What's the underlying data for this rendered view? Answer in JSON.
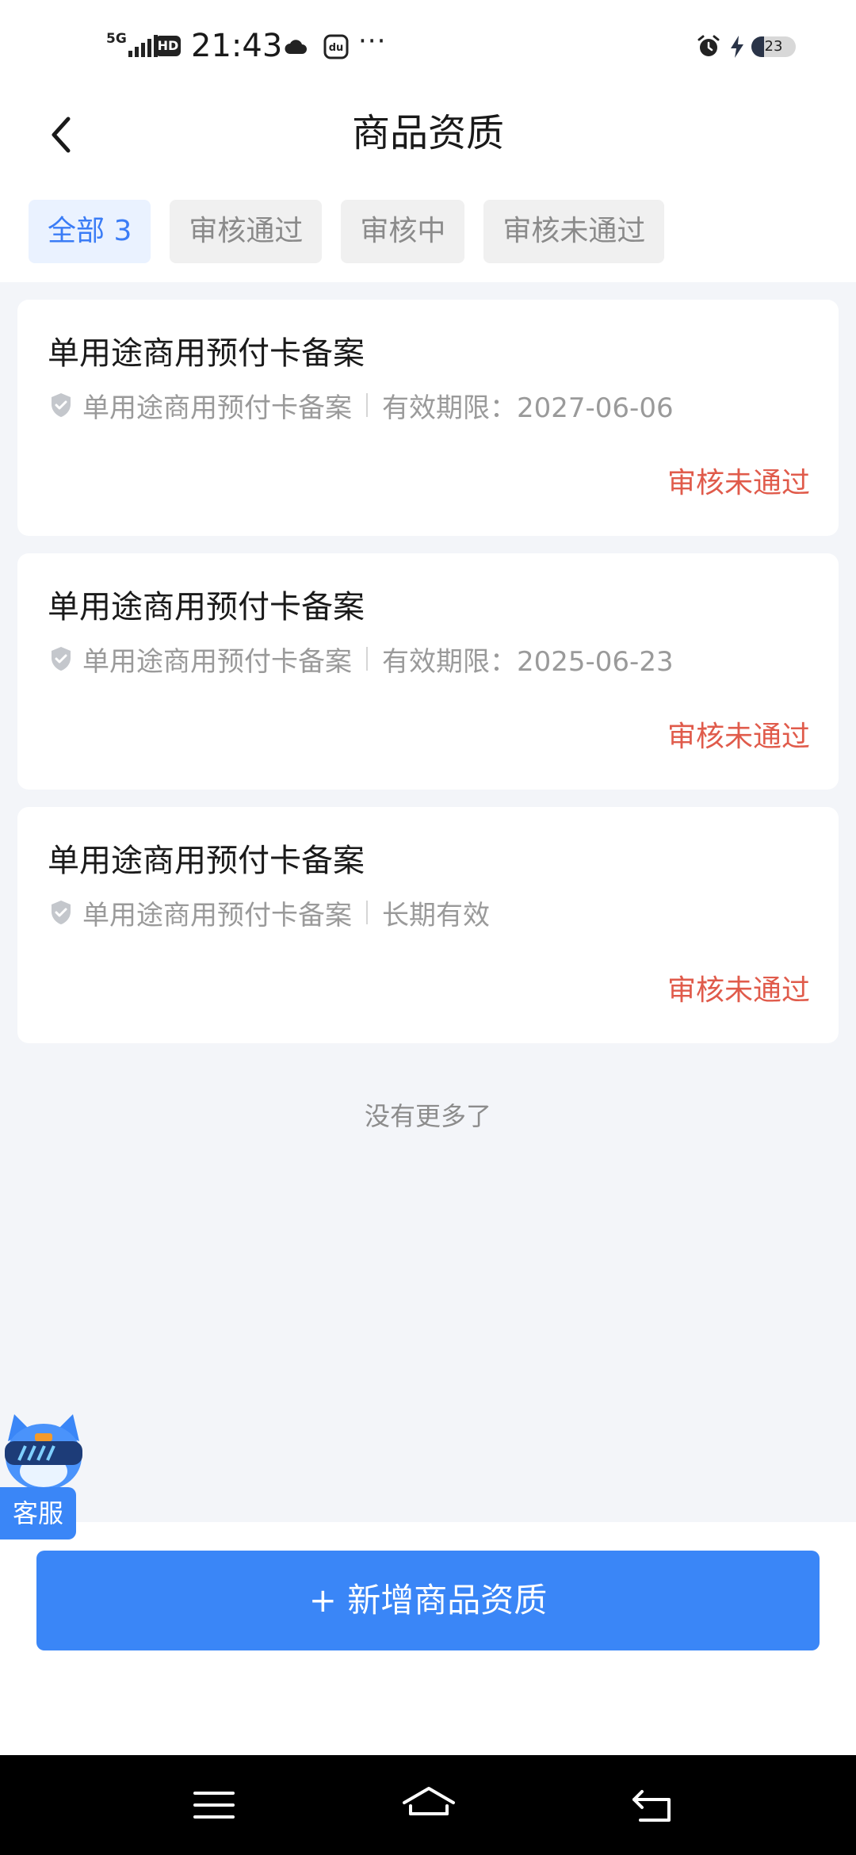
{
  "status_bar": {
    "signal": "5G",
    "hd": "HD",
    "time": "21:43",
    "more": "···",
    "battery": "23",
    "icons": [
      "cloud-icon",
      "du-app-icon",
      "alarm-icon",
      "charging-icon"
    ]
  },
  "nav": {
    "title": "商品资质",
    "back_icon": "chevron-left-icon"
  },
  "tabs": [
    {
      "label": "全部 3",
      "active": true
    },
    {
      "label": "审核通过",
      "active": false
    },
    {
      "label": "审核中",
      "active": false
    },
    {
      "label": "审核未通过",
      "active": false
    }
  ],
  "cards": [
    {
      "title": "单用途商用预付卡备案",
      "type": "单用途商用预付卡备案",
      "validity": "有效期限：2027-06-06",
      "status": "审核未通过"
    },
    {
      "title": "单用途商用预付卡备案",
      "type": "单用途商用预付卡备案",
      "validity": "有效期限：2025-06-23",
      "status": "审核未通过"
    },
    {
      "title": "单用途商用预付卡备案",
      "type": "单用途商用预付卡备案",
      "validity": "长期有效",
      "status": "审核未通过"
    }
  ],
  "no_more": "没有更多了",
  "customer_service": {
    "label": "客服"
  },
  "add_button": {
    "label": "+ 新增商品资质"
  },
  "colors": {
    "accent": "#3a86f7",
    "tab_active_text": "#3a7cf6",
    "status_rejected": "#e05b4b",
    "page_bg": "#f3f5f9"
  }
}
